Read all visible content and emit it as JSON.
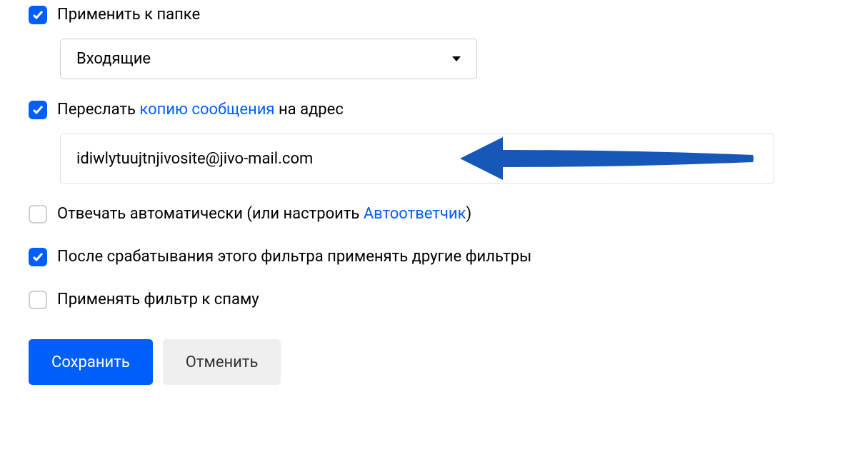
{
  "options": {
    "apply_to_folder": {
      "checked": true,
      "label": "Применить к папке",
      "selected_folder": "Входящие"
    },
    "forward": {
      "checked": true,
      "label_prefix": "Переслать ",
      "label_link": "копию сообщения",
      "label_suffix": " на адрес",
      "email_value": "idiwlytuujtnjivosite@jivo-mail.com"
    },
    "auto_reply": {
      "checked": false,
      "label_prefix": "Отвечать автоматически (или настроить ",
      "label_link": "Автоответчик",
      "label_suffix": ")"
    },
    "apply_other_filters": {
      "checked": true,
      "label": "После срабатывания этого фильтра применять другие фильтры"
    },
    "apply_to_spam": {
      "checked": false,
      "label": "Применять фильтр к спаму"
    }
  },
  "buttons": {
    "save": "Сохранить",
    "cancel": "Отменить"
  },
  "colors": {
    "primary": "#005ff9",
    "arrow": "#1757b8"
  }
}
